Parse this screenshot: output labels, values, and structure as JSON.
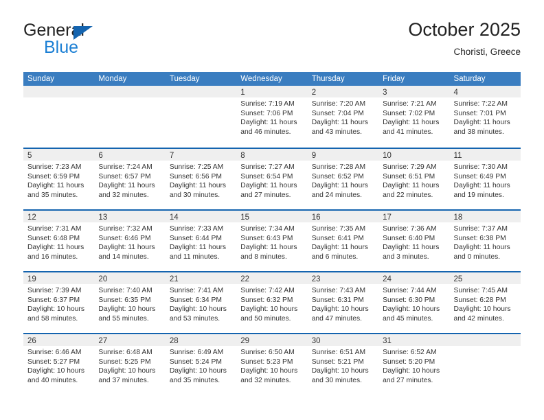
{
  "brand": {
    "name_part1": "General",
    "name_part2": "Blue",
    "accent_color": "#1b7fd4",
    "triangle_color": "#1464af"
  },
  "header": {
    "title": "October 2025",
    "subtitle": "Choristi, Greece"
  },
  "calendar": {
    "header_bg": "#3a7dc0",
    "weekday_headers": [
      "Sunday",
      "Monday",
      "Tuesday",
      "Wednesday",
      "Thursday",
      "Friday",
      "Saturday"
    ],
    "weeks": [
      [
        {
          "day": "",
          "lines": []
        },
        {
          "day": "",
          "lines": []
        },
        {
          "day": "",
          "lines": []
        },
        {
          "day": "1",
          "lines": [
            "Sunrise: 7:19 AM",
            "Sunset: 7:06 PM",
            "Daylight: 11 hours",
            "and 46 minutes."
          ]
        },
        {
          "day": "2",
          "lines": [
            "Sunrise: 7:20 AM",
            "Sunset: 7:04 PM",
            "Daylight: 11 hours",
            "and 43 minutes."
          ]
        },
        {
          "day": "3",
          "lines": [
            "Sunrise: 7:21 AM",
            "Sunset: 7:02 PM",
            "Daylight: 11 hours",
            "and 41 minutes."
          ]
        },
        {
          "day": "4",
          "lines": [
            "Sunrise: 7:22 AM",
            "Sunset: 7:01 PM",
            "Daylight: 11 hours",
            "and 38 minutes."
          ]
        }
      ],
      [
        {
          "day": "5",
          "lines": [
            "Sunrise: 7:23 AM",
            "Sunset: 6:59 PM",
            "Daylight: 11 hours",
            "and 35 minutes."
          ]
        },
        {
          "day": "6",
          "lines": [
            "Sunrise: 7:24 AM",
            "Sunset: 6:57 PM",
            "Daylight: 11 hours",
            "and 32 minutes."
          ]
        },
        {
          "day": "7",
          "lines": [
            "Sunrise: 7:25 AM",
            "Sunset: 6:56 PM",
            "Daylight: 11 hours",
            "and 30 minutes."
          ]
        },
        {
          "day": "8",
          "lines": [
            "Sunrise: 7:27 AM",
            "Sunset: 6:54 PM",
            "Daylight: 11 hours",
            "and 27 minutes."
          ]
        },
        {
          "day": "9",
          "lines": [
            "Sunrise: 7:28 AM",
            "Sunset: 6:52 PM",
            "Daylight: 11 hours",
            "and 24 minutes."
          ]
        },
        {
          "day": "10",
          "lines": [
            "Sunrise: 7:29 AM",
            "Sunset: 6:51 PM",
            "Daylight: 11 hours",
            "and 22 minutes."
          ]
        },
        {
          "day": "11",
          "lines": [
            "Sunrise: 7:30 AM",
            "Sunset: 6:49 PM",
            "Daylight: 11 hours",
            "and 19 minutes."
          ]
        }
      ],
      [
        {
          "day": "12",
          "lines": [
            "Sunrise: 7:31 AM",
            "Sunset: 6:48 PM",
            "Daylight: 11 hours",
            "and 16 minutes."
          ]
        },
        {
          "day": "13",
          "lines": [
            "Sunrise: 7:32 AM",
            "Sunset: 6:46 PM",
            "Daylight: 11 hours",
            "and 14 minutes."
          ]
        },
        {
          "day": "14",
          "lines": [
            "Sunrise: 7:33 AM",
            "Sunset: 6:44 PM",
            "Daylight: 11 hours",
            "and 11 minutes."
          ]
        },
        {
          "day": "15",
          "lines": [
            "Sunrise: 7:34 AM",
            "Sunset: 6:43 PM",
            "Daylight: 11 hours",
            "and 8 minutes."
          ]
        },
        {
          "day": "16",
          "lines": [
            "Sunrise: 7:35 AM",
            "Sunset: 6:41 PM",
            "Daylight: 11 hours",
            "and 6 minutes."
          ]
        },
        {
          "day": "17",
          "lines": [
            "Sunrise: 7:36 AM",
            "Sunset: 6:40 PM",
            "Daylight: 11 hours",
            "and 3 minutes."
          ]
        },
        {
          "day": "18",
          "lines": [
            "Sunrise: 7:37 AM",
            "Sunset: 6:38 PM",
            "Daylight: 11 hours",
            "and 0 minutes."
          ]
        }
      ],
      [
        {
          "day": "19",
          "lines": [
            "Sunrise: 7:39 AM",
            "Sunset: 6:37 PM",
            "Daylight: 10 hours",
            "and 58 minutes."
          ]
        },
        {
          "day": "20",
          "lines": [
            "Sunrise: 7:40 AM",
            "Sunset: 6:35 PM",
            "Daylight: 10 hours",
            "and 55 minutes."
          ]
        },
        {
          "day": "21",
          "lines": [
            "Sunrise: 7:41 AM",
            "Sunset: 6:34 PM",
            "Daylight: 10 hours",
            "and 53 minutes."
          ]
        },
        {
          "day": "22",
          "lines": [
            "Sunrise: 7:42 AM",
            "Sunset: 6:32 PM",
            "Daylight: 10 hours",
            "and 50 minutes."
          ]
        },
        {
          "day": "23",
          "lines": [
            "Sunrise: 7:43 AM",
            "Sunset: 6:31 PM",
            "Daylight: 10 hours",
            "and 47 minutes."
          ]
        },
        {
          "day": "24",
          "lines": [
            "Sunrise: 7:44 AM",
            "Sunset: 6:30 PM",
            "Daylight: 10 hours",
            "and 45 minutes."
          ]
        },
        {
          "day": "25",
          "lines": [
            "Sunrise: 7:45 AM",
            "Sunset: 6:28 PM",
            "Daylight: 10 hours",
            "and 42 minutes."
          ]
        }
      ],
      [
        {
          "day": "26",
          "lines": [
            "Sunrise: 6:46 AM",
            "Sunset: 5:27 PM",
            "Daylight: 10 hours",
            "and 40 minutes."
          ]
        },
        {
          "day": "27",
          "lines": [
            "Sunrise: 6:48 AM",
            "Sunset: 5:25 PM",
            "Daylight: 10 hours",
            "and 37 minutes."
          ]
        },
        {
          "day": "28",
          "lines": [
            "Sunrise: 6:49 AM",
            "Sunset: 5:24 PM",
            "Daylight: 10 hours",
            "and 35 minutes."
          ]
        },
        {
          "day": "29",
          "lines": [
            "Sunrise: 6:50 AM",
            "Sunset: 5:23 PM",
            "Daylight: 10 hours",
            "and 32 minutes."
          ]
        },
        {
          "day": "30",
          "lines": [
            "Sunrise: 6:51 AM",
            "Sunset: 5:21 PM",
            "Daylight: 10 hours",
            "and 30 minutes."
          ]
        },
        {
          "day": "31",
          "lines": [
            "Sunrise: 6:52 AM",
            "Sunset: 5:20 PM",
            "Daylight: 10 hours",
            "and 27 minutes."
          ]
        },
        {
          "day": "",
          "lines": []
        }
      ]
    ]
  }
}
